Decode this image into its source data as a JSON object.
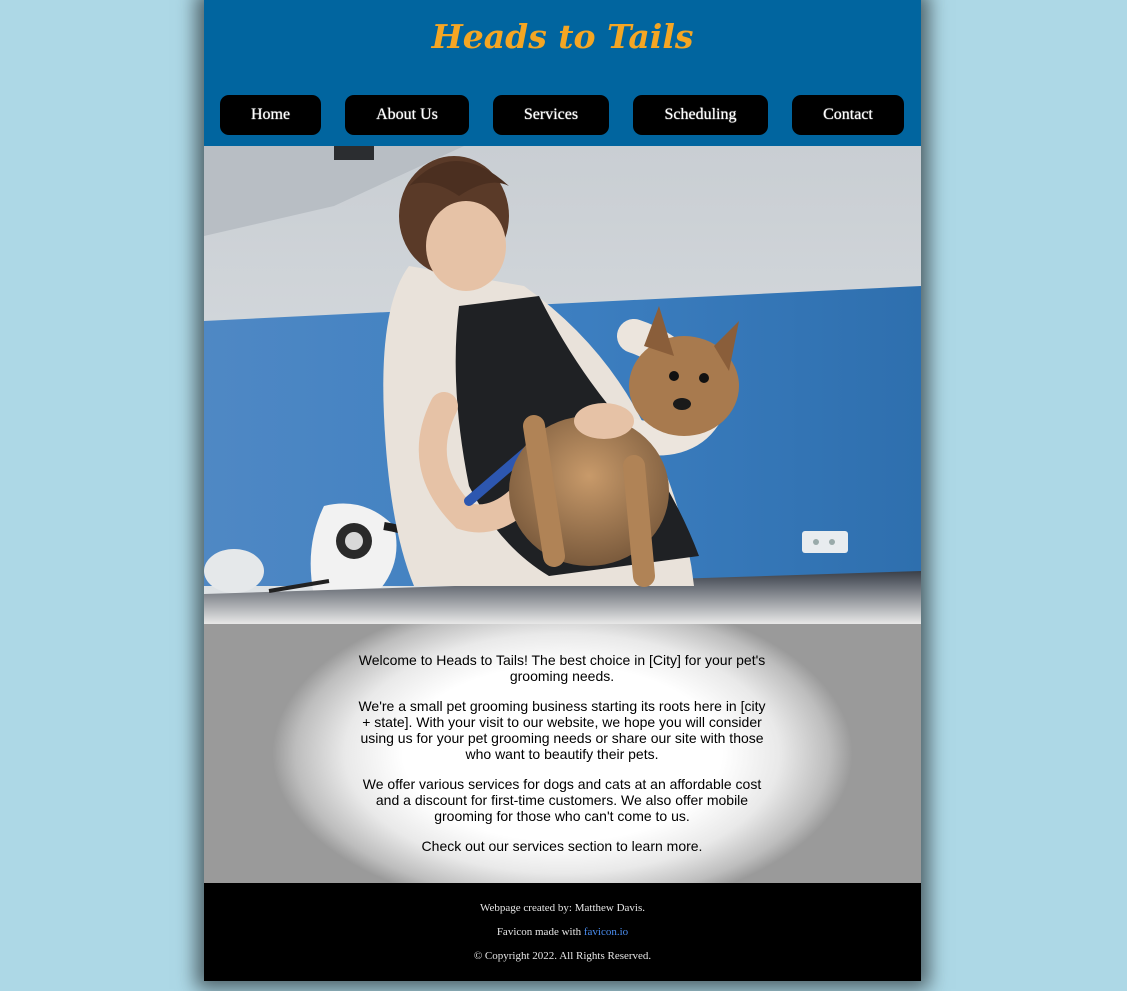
{
  "site": {
    "title": "Heads to Tails",
    "title_color": "#f5a623",
    "header_color": "#01659f",
    "background_color": "#add8e6"
  },
  "nav": {
    "home": "Home",
    "about": "About Us",
    "services": "Services",
    "scheduling": "Scheduling",
    "contact": "Contact"
  },
  "hero": {
    "image": "groomer-trimming-yorkshire-terrier-nails"
  },
  "content": {
    "p1": "Welcome to Heads to Tails! The best choice in [City] for your pet's grooming needs.",
    "p2": "We're a small pet grooming business starting its roots here in [city + state]. With your visit to our website, we hope you will consider using us for your pet grooming needs or share our site with those who want to beautify their pets.",
    "p3": "We offer various services for dogs and cats at an affordable cost and a discount for first-time customers. We also offer mobile grooming for those who can't come to us.",
    "p4": "Check out our services section to learn more."
  },
  "footer": {
    "credit": "Webpage created by: Matthew Davis.",
    "favicon_prefix": "Favicon made with ",
    "favicon_link": "favicon.io",
    "copyright": "© Copyright 2022. All Rights Reserved.",
    "link_color": "#4a8df0"
  }
}
